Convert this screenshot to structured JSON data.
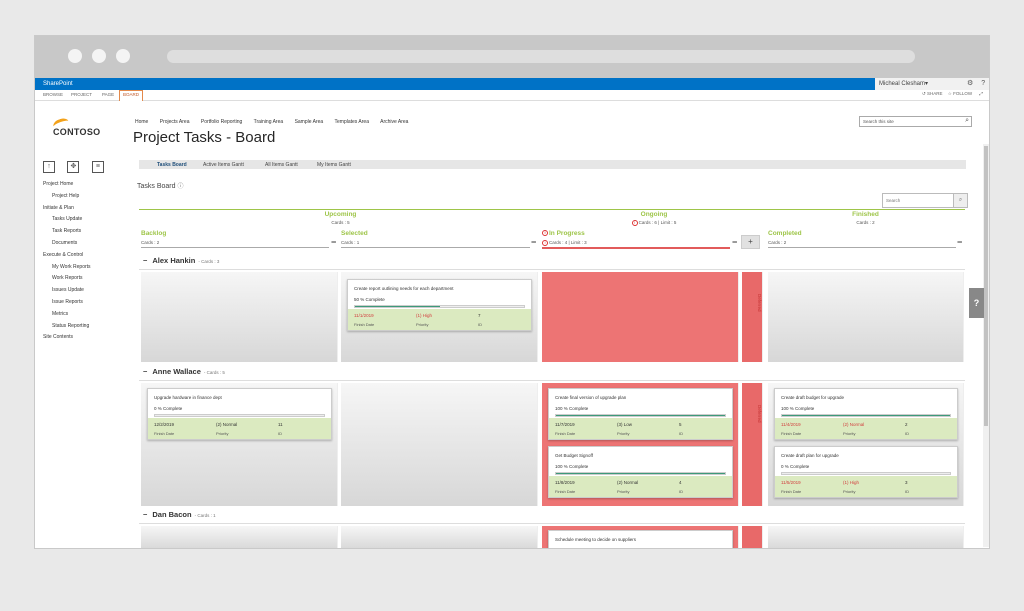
{
  "app": {
    "suite_title": "SharePoint",
    "user": "Micheal Clesham",
    "user_caret": "▾",
    "gear_glyph": "⚙",
    "help_glyph": "?"
  },
  "ribbon": {
    "tabs": [
      "BROWSE",
      "PROJECT",
      "PAGE",
      "BOARD"
    ],
    "share": "SHARE",
    "follow": "FOLLOW"
  },
  "logo": {
    "text": "CONTOSO"
  },
  "topnav": [
    "Home",
    "Projects Area",
    "Portfolio Reporting",
    "Training Area",
    "Sample Area",
    "Templates Area",
    "Archive Area"
  ],
  "page_title": "Project Tasks - Board",
  "search_site": {
    "placeholder": "Search this site",
    "icon": "search-icon"
  },
  "leftnav": [
    {
      "label": "Project Home",
      "sub": false
    },
    {
      "label": "Project Help",
      "sub": true
    },
    {
      "label": "Initiate & Plan",
      "sub": false
    },
    {
      "label": "Tasks Update",
      "sub": true
    },
    {
      "label": "Task Reports",
      "sub": true
    },
    {
      "label": "Documents",
      "sub": true
    },
    {
      "label": "Execute & Control",
      "sub": false
    },
    {
      "label": "My Work Reports",
      "sub": true
    },
    {
      "label": "Work Reports",
      "sub": true
    },
    {
      "label": "Issues Update",
      "sub": true
    },
    {
      "label": "Issue Reports",
      "sub": true
    },
    {
      "label": "Metrics",
      "sub": true
    },
    {
      "label": "Status Reporting",
      "sub": true
    },
    {
      "label": "Site Contents",
      "sub": false
    }
  ],
  "view_tabs": [
    "Tasks Board",
    "Active Items Gantt",
    "All Items Gantt",
    "My Items Gantt"
  ],
  "board": {
    "label": "Tasks Board",
    "info_glyph": "ⓘ",
    "search_placeholder": "Search",
    "groups": [
      {
        "name": "Upcoming",
        "count": "Cards : 5"
      },
      {
        "name": "Ongoing",
        "count": "Cards : 6 | Limit : 5"
      },
      {
        "name": "Finished",
        "count": "Cards : 2"
      }
    ],
    "columns": [
      {
        "name": "Backlog",
        "count": "Cards : 2"
      },
      {
        "name": "Selected",
        "count": "Cards : 1"
      },
      {
        "name": "In Progress",
        "count": "Cards : 4 | Limit : 3"
      },
      {
        "name": "Completed",
        "count": "Cards : 2"
      }
    ],
    "minus": "−",
    "plus": "+",
    "deferred_label": "Deferred",
    "swimlanes": [
      {
        "name": "Alex Hankin",
        "count": "- Cards : 3"
      },
      {
        "name": "Anne Wallace",
        "count": "- Cards : 5"
      },
      {
        "name": "Dan Bacon",
        "count": "- Cards : 1"
      }
    ],
    "field_labels": {
      "finish": "Finish Date",
      "priority": "Priority",
      "id": "ID"
    },
    "cards": [
      {
        "title": "Create report outlining needs for each department",
        "pct": "50 % Complete",
        "progress": 0.5,
        "date": "11/1/2019",
        "priority": "(1) High",
        "id": "7",
        "overdue": true
      },
      {
        "title": "Upgrade hardware in finance dept",
        "pct": "0 % Complete",
        "progress": 0,
        "date": "12/2/2019",
        "priority": "(2) Normal",
        "id": "11",
        "overdue": false
      },
      {
        "title": "Create final version of upgrade plan",
        "pct": "100 % Complete",
        "progress": 1,
        "date": "11/7/2019",
        "priority": "(3) Low",
        "id": "5",
        "overdue": false
      },
      {
        "title": "Get Budget Signoff",
        "pct": "100 % Complete",
        "progress": 1,
        "date": "11/8/2019",
        "priority": "(2) Normal",
        "id": "4",
        "overdue": false
      },
      {
        "title": "Create draft budget for upgrade",
        "pct": "100 % Complete",
        "progress": 1,
        "date": "11/4/2019",
        "priority": "(2) Normal",
        "id": "2",
        "overdue": true
      },
      {
        "title": "Create draft plan for upgrade",
        "pct": "0 % Complete",
        "progress": 0,
        "date": "11/5/2019",
        "priority": "(1) High",
        "id": "3",
        "overdue": true
      },
      {
        "title": "Schedule meeting to decide on suppliers",
        "pct": "",
        "progress": 0,
        "date": "",
        "priority": "",
        "id": "",
        "overdue": false
      }
    ]
  },
  "floating_help": "?",
  "colors": {
    "accent": "#0072c6",
    "wip_over": "#ed7474",
    "column_header": "#9ec549",
    "card_footer": "#dbeac0",
    "progress": "#3d9a7a",
    "ribbon_active": "#e3894b"
  }
}
